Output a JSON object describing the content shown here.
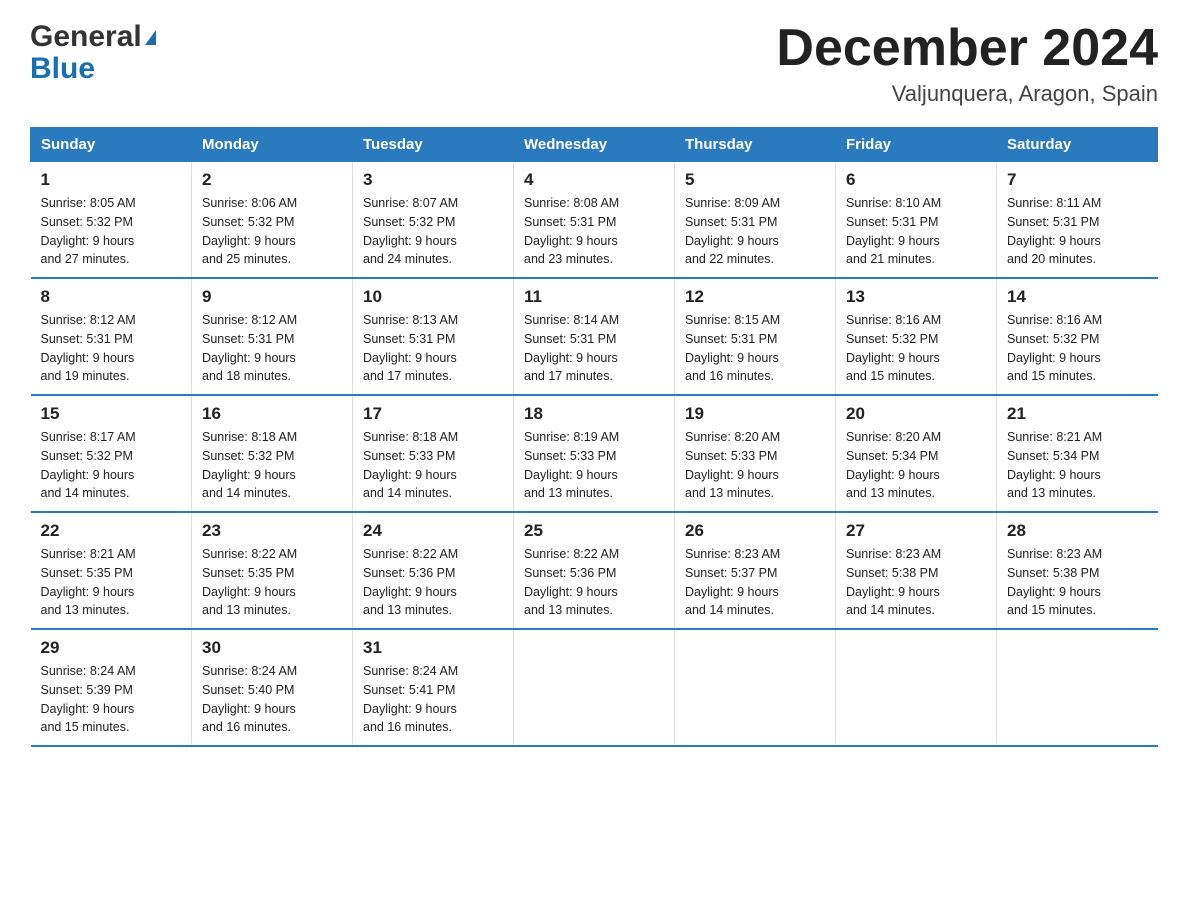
{
  "logo": {
    "general": "General",
    "blue": "Blue",
    "triangle": "▲"
  },
  "title": {
    "month": "December 2024",
    "location": "Valjunquera, Aragon, Spain"
  },
  "days_of_week": [
    "Sunday",
    "Monday",
    "Tuesday",
    "Wednesday",
    "Thursday",
    "Friday",
    "Saturday"
  ],
  "weeks": [
    [
      {
        "day": "1",
        "sunrise": "8:05 AM",
        "sunset": "5:32 PM",
        "daylight": "9 hours and 27 minutes."
      },
      {
        "day": "2",
        "sunrise": "8:06 AM",
        "sunset": "5:32 PM",
        "daylight": "9 hours and 25 minutes."
      },
      {
        "day": "3",
        "sunrise": "8:07 AM",
        "sunset": "5:32 PM",
        "daylight": "9 hours and 24 minutes."
      },
      {
        "day": "4",
        "sunrise": "8:08 AM",
        "sunset": "5:31 PM",
        "daylight": "9 hours and 23 minutes."
      },
      {
        "day": "5",
        "sunrise": "8:09 AM",
        "sunset": "5:31 PM",
        "daylight": "9 hours and 22 minutes."
      },
      {
        "day": "6",
        "sunrise": "8:10 AM",
        "sunset": "5:31 PM",
        "daylight": "9 hours and 21 minutes."
      },
      {
        "day": "7",
        "sunrise": "8:11 AM",
        "sunset": "5:31 PM",
        "daylight": "9 hours and 20 minutes."
      }
    ],
    [
      {
        "day": "8",
        "sunrise": "8:12 AM",
        "sunset": "5:31 PM",
        "daylight": "9 hours and 19 minutes."
      },
      {
        "day": "9",
        "sunrise": "8:12 AM",
        "sunset": "5:31 PM",
        "daylight": "9 hours and 18 minutes."
      },
      {
        "day": "10",
        "sunrise": "8:13 AM",
        "sunset": "5:31 PM",
        "daylight": "9 hours and 17 minutes."
      },
      {
        "day": "11",
        "sunrise": "8:14 AM",
        "sunset": "5:31 PM",
        "daylight": "9 hours and 17 minutes."
      },
      {
        "day": "12",
        "sunrise": "8:15 AM",
        "sunset": "5:31 PM",
        "daylight": "9 hours and 16 minutes."
      },
      {
        "day": "13",
        "sunrise": "8:16 AM",
        "sunset": "5:32 PM",
        "daylight": "9 hours and 15 minutes."
      },
      {
        "day": "14",
        "sunrise": "8:16 AM",
        "sunset": "5:32 PM",
        "daylight": "9 hours and 15 minutes."
      }
    ],
    [
      {
        "day": "15",
        "sunrise": "8:17 AM",
        "sunset": "5:32 PM",
        "daylight": "9 hours and 14 minutes."
      },
      {
        "day": "16",
        "sunrise": "8:18 AM",
        "sunset": "5:32 PM",
        "daylight": "9 hours and 14 minutes."
      },
      {
        "day": "17",
        "sunrise": "8:18 AM",
        "sunset": "5:33 PM",
        "daylight": "9 hours and 14 minutes."
      },
      {
        "day": "18",
        "sunrise": "8:19 AM",
        "sunset": "5:33 PM",
        "daylight": "9 hours and 13 minutes."
      },
      {
        "day": "19",
        "sunrise": "8:20 AM",
        "sunset": "5:33 PM",
        "daylight": "9 hours and 13 minutes."
      },
      {
        "day": "20",
        "sunrise": "8:20 AM",
        "sunset": "5:34 PM",
        "daylight": "9 hours and 13 minutes."
      },
      {
        "day": "21",
        "sunrise": "8:21 AM",
        "sunset": "5:34 PM",
        "daylight": "9 hours and 13 minutes."
      }
    ],
    [
      {
        "day": "22",
        "sunrise": "8:21 AM",
        "sunset": "5:35 PM",
        "daylight": "9 hours and 13 minutes."
      },
      {
        "day": "23",
        "sunrise": "8:22 AM",
        "sunset": "5:35 PM",
        "daylight": "9 hours and 13 minutes."
      },
      {
        "day": "24",
        "sunrise": "8:22 AM",
        "sunset": "5:36 PM",
        "daylight": "9 hours and 13 minutes."
      },
      {
        "day": "25",
        "sunrise": "8:22 AM",
        "sunset": "5:36 PM",
        "daylight": "9 hours and 13 minutes."
      },
      {
        "day": "26",
        "sunrise": "8:23 AM",
        "sunset": "5:37 PM",
        "daylight": "9 hours and 14 minutes."
      },
      {
        "day": "27",
        "sunrise": "8:23 AM",
        "sunset": "5:38 PM",
        "daylight": "9 hours and 14 minutes."
      },
      {
        "day": "28",
        "sunrise": "8:23 AM",
        "sunset": "5:38 PM",
        "daylight": "9 hours and 15 minutes."
      }
    ],
    [
      {
        "day": "29",
        "sunrise": "8:24 AM",
        "sunset": "5:39 PM",
        "daylight": "9 hours and 15 minutes."
      },
      {
        "day": "30",
        "sunrise": "8:24 AM",
        "sunset": "5:40 PM",
        "daylight": "9 hours and 16 minutes."
      },
      {
        "day": "31",
        "sunrise": "8:24 AM",
        "sunset": "5:41 PM",
        "daylight": "9 hours and 16 minutes."
      },
      null,
      null,
      null,
      null
    ]
  ],
  "labels": {
    "sunrise": "Sunrise:",
    "sunset": "Sunset:",
    "daylight": "Daylight:"
  }
}
